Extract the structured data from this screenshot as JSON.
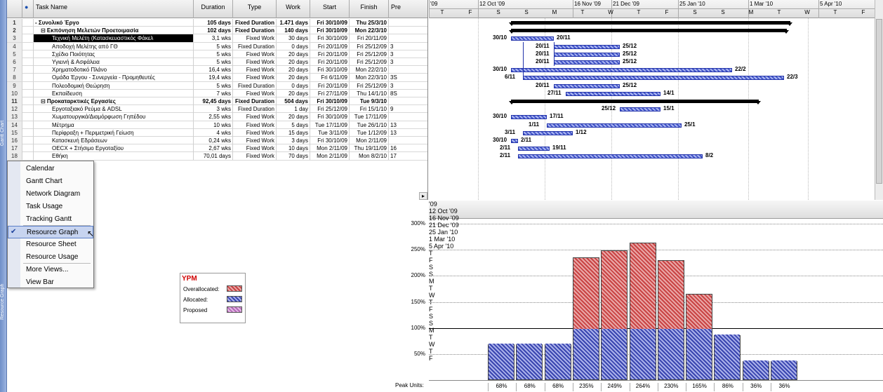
{
  "table": {
    "headers": [
      "",
      "Task Name",
      "Duration",
      "Type",
      "Work",
      "Start",
      "Finish",
      "Pre"
    ],
    "rows": [
      {
        "id": "1",
        "name": "- Συνολικό Έργο",
        "duration": "105 days",
        "type": "Fixed Duration",
        "work": "1.471 days",
        "start": "Fri 30/10/09",
        "finish": "Thu 25/3/10",
        "pre": "",
        "bold": true
      },
      {
        "id": "2",
        "name": "⊟ Εκπόνηση Μελετών  Προετοιμασία",
        "duration": "102 days",
        "type": "Fixed Duration",
        "work": "140 days",
        "start": "Fri 30/10/09",
        "finish": "Mon 22/3/10",
        "pre": "",
        "bold": true
      },
      {
        "id": "3",
        "name": "Τεχνική Μελέτη (Κατασκευαστικός Φάκελ",
        "duration": "3,1 wks",
        "type": "Fixed Work",
        "work": "30 days",
        "start": "Fri 30/10/09",
        "finish": "Fri 20/11/09",
        "pre": "",
        "sel": true
      },
      {
        "id": "4",
        "name": "Αποδοχή Μελέτης από ΓΘ",
        "duration": "5 wks",
        "type": "Fixed Duration",
        "work": "0 days",
        "start": "Fri 20/11/09",
        "finish": "Fri 25/12/09",
        "pre": "3"
      },
      {
        "id": "5",
        "name": "Σχέδιο Ποιότητας",
        "duration": "5 wks",
        "type": "Fixed Work",
        "work": "20 days",
        "start": "Fri 20/11/09",
        "finish": "Fri 25/12/09",
        "pre": "3"
      },
      {
        "id": "6",
        "name": "Υγιεινή & Ασφάλεια",
        "duration": "5 wks",
        "type": "Fixed Work",
        "work": "20 days",
        "start": "Fri 20/11/09",
        "finish": "Fri 25/12/09",
        "pre": "3"
      },
      {
        "id": "7",
        "name": "Χρηματοδοτικό Πλάνο",
        "duration": "16,4 wks",
        "type": "Fixed Work",
        "work": "20 days",
        "start": "Fri 30/10/09",
        "finish": "Mon 22/2/10",
        "pre": ""
      },
      {
        "id": "8",
        "name": "Ομάδα Έργου - Συνεργεία - Προμηθευτές",
        "duration": "19,4 wks",
        "type": "Fixed Work",
        "work": "20 days",
        "start": "Fri 6/11/09",
        "finish": "Mon 22/3/10",
        "pre": "3S"
      },
      {
        "id": "9",
        "name": "Πολεοδομική Θεώρηση",
        "duration": "5 wks",
        "type": "Fixed Duration",
        "work": "0 days",
        "start": "Fri 20/11/09",
        "finish": "Fri 25/12/09",
        "pre": "3"
      },
      {
        "id": "10",
        "name": "Εκπαίδευση",
        "duration": "7 wks",
        "type": "Fixed Work",
        "work": "20 days",
        "start": "Fri 27/11/09",
        "finish": "Thu 14/1/10",
        "pre": "8S"
      },
      {
        "id": "11",
        "name": "⊟ Προκαταρκτικές Εργασίες",
        "duration": "92,45 days",
        "type": "Fixed Duration",
        "work": "504 days",
        "start": "Fri 30/10/09",
        "finish": "Tue 9/3/10",
        "pre": "",
        "bold": true
      },
      {
        "id": "12",
        "name": "Εργοταξιακό Ρεύμα & ADSL",
        "duration": "3 wks",
        "type": "Fixed Duration",
        "work": "1 day",
        "start": "Fri 25/12/09",
        "finish": "Fri 15/1/10",
        "pre": "9"
      },
      {
        "id": "13",
        "name": "Χωματουργικά/Διαμόρφωση Γηπέδου",
        "duration": "2,55 wks",
        "type": "Fixed Work",
        "work": "20 days",
        "start": "Fri 30/10/09",
        "finish": "Tue 17/11/09",
        "pre": ""
      },
      {
        "id": "14",
        "name": "Μέτρημα",
        "duration": "10 wks",
        "type": "Fixed Work",
        "work": "5 days",
        "start": "Tue 17/11/09",
        "finish": "Tue 26/1/10",
        "pre": "13"
      },
      {
        "id": "15",
        "name": "Περίφραξη + Περιμετρική Γείωση",
        "duration": "4 wks",
        "type": "Fixed Work",
        "work": "15 days",
        "start": "Tue 3/11/09",
        "finish": "Tue 1/12/09",
        "pre": "13"
      },
      {
        "id": "16",
        "name": "Κατασκευή Εδράσεων",
        "duration": "0,24 wks",
        "type": "Fixed Work",
        "work": "3 days",
        "start": "Fri 30/10/09",
        "finish": "Mon 2/11/09",
        "pre": ""
      },
      {
        "id": "17",
        "name": "OECX + Στήσιμο Εργοταξίου",
        "duration": "2,67 wks",
        "type": "Fixed Work",
        "work": "10 days",
        "start": "Mon 2/11/09",
        "finish": "Thu 19/11/09",
        "pre": "16"
      },
      {
        "id": "18",
        "name": "Εθήκη",
        "duration": "70,01 days",
        "type": "Fixed Work",
        "work": "70 days",
        "start": "Mon 2/11/09",
        "finish": "Mon 8/2/10",
        "pre": "17"
      }
    ]
  },
  "timescale": {
    "weeks": [
      "'09",
      "12 Oct '09",
      "16 Nov '09",
      "21 Dec '09",
      "25 Jan '10",
      "1 Mar '10",
      "5 Apr '10"
    ],
    "days": [
      "T",
      "F",
      "S",
      "S",
      "M",
      "T",
      "W",
      "T",
      "F",
      "S",
      "S",
      "M",
      "T",
      "W",
      "T",
      "F"
    ]
  },
  "gantt_labels": [
    {
      "text": "30/10"
    },
    {
      "text": "20/11"
    },
    {
      "text": "20/11"
    },
    {
      "text": "25/12"
    },
    {
      "text": "20/11"
    },
    {
      "text": "25/12"
    },
    {
      "text": "20/11"
    },
    {
      "text": "25/12"
    },
    {
      "text": "30/10"
    },
    {
      "text": "22/2"
    },
    {
      "text": "6/11"
    },
    {
      "text": "22/3"
    },
    {
      "text": "20/11"
    },
    {
      "text": "25/12"
    },
    {
      "text": "27/11"
    },
    {
      "text": "14/1"
    },
    {
      "text": "25/12"
    },
    {
      "text": "15/1"
    },
    {
      "text": "30/10"
    },
    {
      "text": "17/11"
    },
    {
      "text": "1/11"
    },
    {
      "text": "25/1"
    },
    {
      "text": "3/11"
    },
    {
      "text": "1/12"
    },
    {
      "text": "30/10"
    },
    {
      "text": "2/11"
    },
    {
      "text": "2/11"
    },
    {
      "text": "19/11"
    },
    {
      "text": "2/11"
    },
    {
      "text": "8/2"
    }
  ],
  "menu": {
    "items": [
      "Calendar",
      "Gantt Chart",
      "Network Diagram",
      "Task Usage",
      "Tracking Gantt",
      "Resource Graph",
      "Resource Sheet",
      "Resource Usage",
      "More Views...",
      "View Bar"
    ],
    "active": "Resource Graph"
  },
  "legend": {
    "title": "YPM",
    "overallocated": "Overallocated:",
    "allocated": "Allocated:",
    "proposed": "Proposed",
    "colors": {
      "overallocated": "#c94444",
      "allocated": "#3a46b0",
      "proposed": "#b56bb8"
    }
  },
  "viewbar": {
    "top_label": "Gantt Chart",
    "bottom_label": "Resource Graph"
  },
  "graph": {
    "peak_label": "Peak Units:"
  },
  "chart_data": {
    "type": "bar",
    "title": "",
    "xlabel": "",
    "ylabel": "",
    "ylim": [
      0,
      300
    ],
    "yticks": [
      "300%",
      "250%",
      "200%",
      "150%",
      "100%",
      "50%"
    ],
    "categories": [
      "68%",
      "68%",
      "68%",
      "235%",
      "249%",
      "264%",
      "230%",
      "165%",
      "86%",
      "36%",
      "36%"
    ],
    "values": [
      68,
      68,
      68,
      235,
      249,
      264,
      230,
      165,
      86,
      36,
      36
    ],
    "max_units": 100
  }
}
